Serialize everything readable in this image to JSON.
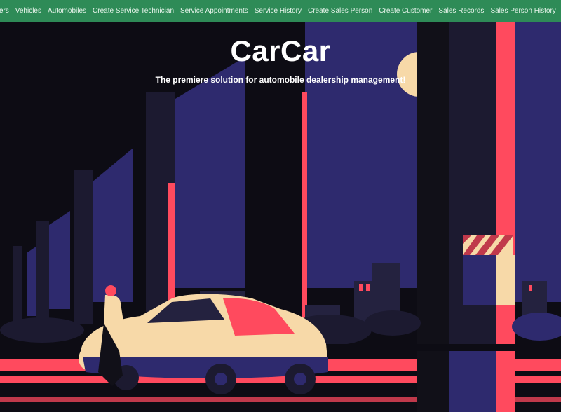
{
  "nav": {
    "items": [
      {
        "label": "rers",
        "name": "nav-link-manufacturers"
      },
      {
        "label": "Vehicles",
        "name": "nav-link-vehicles"
      },
      {
        "label": "Automobiles",
        "name": "nav-link-automobiles"
      },
      {
        "label": "Create Service Technician",
        "name": "nav-link-create-service-technician"
      },
      {
        "label": "Service Appointments",
        "name": "nav-link-service-appointments"
      },
      {
        "label": "Service History",
        "name": "nav-link-service-history"
      },
      {
        "label": "Create Sales Person",
        "name": "nav-link-create-sales-person"
      },
      {
        "label": "Create Customer",
        "name": "nav-link-create-customer"
      },
      {
        "label": "Sales Records",
        "name": "nav-link-sales-records"
      },
      {
        "label": "Sales Person History",
        "name": "nav-link-sales-person-history"
      }
    ]
  },
  "hero": {
    "title": "CarCar",
    "subtitle": "The premiere solution for automobile dealership management!"
  },
  "colors": {
    "navbar": "#2e8b57",
    "sky": "#2e2a6e",
    "neon_red": "#ff4a5e",
    "car_cream": "#f7d9a8",
    "night_black": "#0d0c14"
  }
}
